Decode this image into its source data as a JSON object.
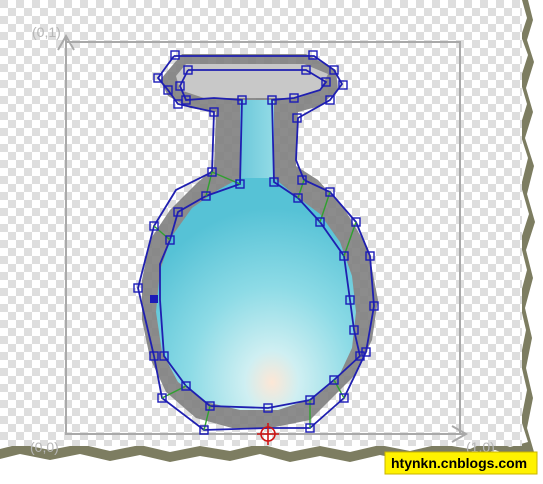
{
  "axes": {
    "origin_label": "(0,0)",
    "y_end_label": "(0,1)",
    "x_end_label": "(1,0)"
  },
  "watermark": {
    "text": "htynkn.cnblogs.com"
  },
  "colors": {
    "checker_light": "#ffffff",
    "checker_dark": "#dedede",
    "grid_line": "#a9a9a9",
    "outline_gray": "#7f7f7f",
    "flask_liquid": "#6fd0df",
    "flask_glow": "#fde7d6",
    "hull_stroke": "#1f1fb0",
    "vertex_stroke": "#1b1bb8",
    "inner_link": "#2fa02f",
    "origin_marker": "#d01515",
    "watermark_bg": "#fff200"
  },
  "icons": {
    "origin_marker": "crosshair-icon",
    "vertex_handle": "square-handle-icon"
  }
}
